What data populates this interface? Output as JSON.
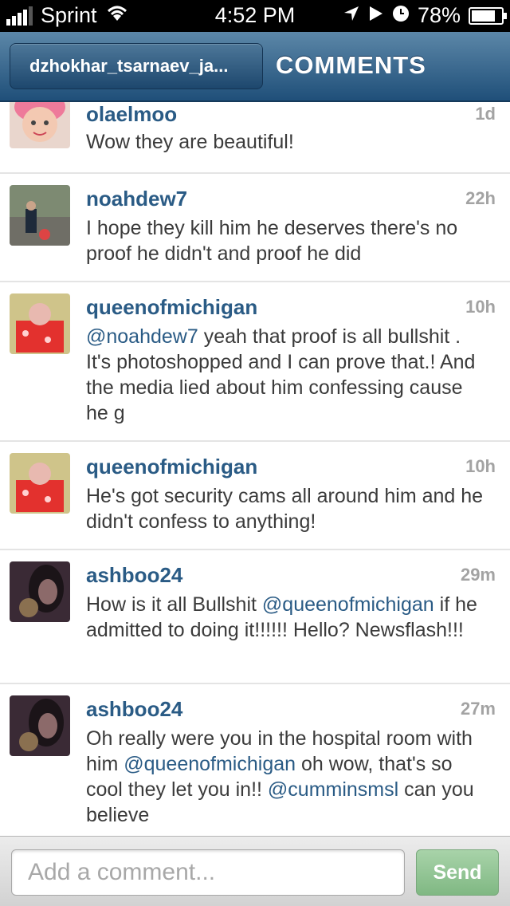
{
  "status_bar": {
    "carrier": "Sprint",
    "time": "4:52 PM",
    "battery": "78%",
    "icons": [
      "signal-icon",
      "wifi-icon",
      "location-icon",
      "play-icon",
      "alarm-icon",
      "battery-charging-icon"
    ]
  },
  "nav": {
    "back_label": "dzhokhar_tsarnaev_ja...",
    "title": "COMMENTS",
    "accent_color": "#2a5b85"
  },
  "comments": [
    {
      "username": "olaelmoo",
      "time": "1d",
      "text": "Wow they are beautiful!"
    },
    {
      "username": "noahdew7",
      "time": "22h",
      "text": "I hope they kill him he deserves there's no proof he didn't and proof he did"
    },
    {
      "username": "queenofmichigan",
      "time": "10h",
      "mention": "@noahdew7",
      "text": " yeah that proof is all bullshit . It's photoshopped and I can prove that.! And the media lied about him confessing cause he g"
    },
    {
      "username": "queenofmichigan",
      "time": "10h",
      "text": "He's got security cams all around him and he didn't confess to anything!"
    },
    {
      "username": "ashboo24",
      "time": "29m",
      "text_before": "How is it all Bullshit ",
      "mention": "@queenofmichigan",
      "text_after": " if he admitted to doing it!!!!!! Hello? Newsflash!!!"
    },
    {
      "username": "ashboo24",
      "time": "27m",
      "text_before": "Oh really were you in the hospital room with him ",
      "mention": "@queenofmichigan",
      "text_after": "  oh wow, that's so cool they let you in!! ",
      "mention2": "@cumminsmsl",
      "text_end": " can you believe"
    }
  ],
  "comment_bar": {
    "placeholder": "Add a comment...",
    "send_label": "Send"
  }
}
